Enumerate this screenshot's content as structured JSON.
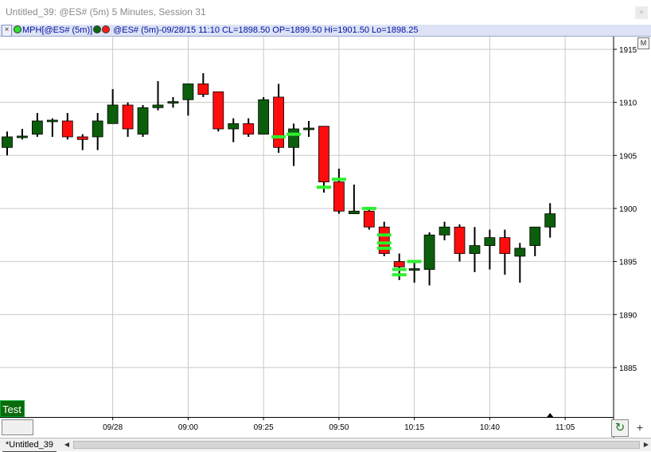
{
  "window": {
    "title": "Untitled_39: @ES# (5m) 5 Minutes, Session 31"
  },
  "legend": {
    "close_glyph": "×",
    "indicator": "MPH[@ES# (5m)]",
    "symbol_info": "@ES# (5m)-09/28/15 11:10 CL=1898.50 OP=1899.50 Hi=1901.50 Lo=1898.25"
  },
  "chart_button": "M",
  "test_label": "Test",
  "tab_label": "*Untitled_39",
  "colors": {
    "up": "#0b5e0b",
    "down": "#ff0d0d",
    "marker": "#2ef02e",
    "wick": "#000000",
    "grid": "#c8c8c8"
  },
  "chart_data": {
    "type": "candlestick",
    "interval": "5m",
    "ylim": [
      1881,
      1917
    ],
    "y_ticks": [
      1915,
      1910,
      1905,
      1900,
      1895,
      1890,
      1885
    ],
    "x_tick_labels": [
      "09/28",
      "09:00",
      "09:25",
      "09:50",
      "10:15",
      "10:40",
      "11:05"
    ],
    "x_tick_bar_index": [
      7,
      12,
      17,
      22,
      27,
      32,
      37
    ],
    "candles": [
      {
        "o": 1905.75,
        "h": 1907.25,
        "l": 1905.0,
        "c": 1906.75
      },
      {
        "o": 1906.75,
        "h": 1907.5,
        "l": 1906.5,
        "c": 1906.75
      },
      {
        "o": 1907.0,
        "h": 1909.0,
        "l": 1906.75,
        "c": 1908.25
      },
      {
        "o": 1908.25,
        "h": 1908.5,
        "l": 1906.75,
        "c": 1908.25
      },
      {
        "o": 1908.25,
        "h": 1909.0,
        "l": 1906.5,
        "c": 1906.75
      },
      {
        "o": 1906.75,
        "h": 1907.0,
        "l": 1905.5,
        "c": 1906.5
      },
      {
        "o": 1906.75,
        "h": 1909.0,
        "l": 1905.5,
        "c": 1908.25
      },
      {
        "o": 1908.0,
        "h": 1911.25,
        "l": 1908.0,
        "c": 1909.75
      },
      {
        "o": 1909.75,
        "h": 1910.0,
        "l": 1906.75,
        "c": 1907.5
      },
      {
        "o": 1907.0,
        "h": 1909.75,
        "l": 1906.75,
        "c": 1909.5
      },
      {
        "o": 1909.5,
        "h": 1912.0,
        "l": 1909.25,
        "c": 1909.75
      },
      {
        "o": 1910.0,
        "h": 1910.5,
        "l": 1909.5,
        "c": 1910.0
      },
      {
        "o": 1910.25,
        "h": 1911.75,
        "l": 1908.75,
        "c": 1911.75
      },
      {
        "o": 1911.75,
        "h": 1912.75,
        "l": 1910.5,
        "c": 1910.75
      },
      {
        "o": 1911.0,
        "h": 1911.0,
        "l": 1907.25,
        "c": 1907.5
      },
      {
        "o": 1907.5,
        "h": 1908.5,
        "l": 1906.25,
        "c": 1908.0
      },
      {
        "o": 1908.0,
        "h": 1908.5,
        "l": 1906.75,
        "c": 1907.0
      },
      {
        "o": 1907.0,
        "h": 1910.5,
        "l": 1907.0,
        "c": 1910.25
      },
      {
        "o": 1910.5,
        "h": 1911.75,
        "l": 1905.25,
        "c": 1905.75
      },
      {
        "o": 1905.75,
        "h": 1908.0,
        "l": 1904.0,
        "c": 1907.5
      },
      {
        "o": 1907.5,
        "h": 1908.25,
        "l": 1906.75,
        "c": 1907.5
      },
      {
        "o": 1907.75,
        "h": 1907.75,
        "l": 1901.5,
        "c": 1902.5
      },
      {
        "o": 1902.5,
        "h": 1903.75,
        "l": 1899.5,
        "c": 1899.75
      },
      {
        "o": 1899.5,
        "h": 1902.25,
        "l": 1899.5,
        "c": 1899.75
      },
      {
        "o": 1899.75,
        "h": 1900.0,
        "l": 1898.0,
        "c": 1898.25
      },
      {
        "o": 1898.25,
        "h": 1898.75,
        "l": 1895.5,
        "c": 1895.75
      },
      {
        "o": 1895.0,
        "h": 1895.75,
        "l": 1893.25,
        "c": 1894.5
      },
      {
        "o": 1894.25,
        "h": 1895.0,
        "l": 1893.0,
        "c": 1894.25
      },
      {
        "o": 1894.25,
        "h": 1897.75,
        "l": 1892.75,
        "c": 1897.5
      },
      {
        "o": 1897.5,
        "h": 1898.75,
        "l": 1897.0,
        "c": 1898.25
      },
      {
        "o": 1898.25,
        "h": 1898.5,
        "l": 1895.0,
        "c": 1895.75
      },
      {
        "o": 1895.75,
        "h": 1898.25,
        "l": 1894.0,
        "c": 1896.5
      },
      {
        "o": 1896.5,
        "h": 1898.0,
        "l": 1894.25,
        "c": 1897.25
      },
      {
        "o": 1897.25,
        "h": 1898.0,
        "l": 1893.75,
        "c": 1895.75
      },
      {
        "o": 1895.5,
        "h": 1896.75,
        "l": 1893.0,
        "c": 1896.25
      },
      {
        "o": 1896.5,
        "h": 1898.25,
        "l": 1895.5,
        "c": 1898.25
      },
      {
        "o": 1898.25,
        "h": 1900.5,
        "l": 1897.25,
        "c": 1899.5
      }
    ],
    "markers": [
      {
        "bar": 18,
        "price": 1906.75
      },
      {
        "bar": 19,
        "price": 1907.0
      },
      {
        "bar": 21,
        "price": 1902.0
      },
      {
        "bar": 22,
        "price": 1902.75
      },
      {
        "bar": 24,
        "price": 1900.0
      },
      {
        "bar": 25,
        "price": 1897.5
      },
      {
        "bar": 25,
        "price": 1896.75
      },
      {
        "bar": 25,
        "price": 1896.25
      },
      {
        "bar": 26,
        "price": 1894.25
      },
      {
        "bar": 26,
        "price": 1893.75
      },
      {
        "bar": 27,
        "price": 1895.0
      }
    ]
  }
}
